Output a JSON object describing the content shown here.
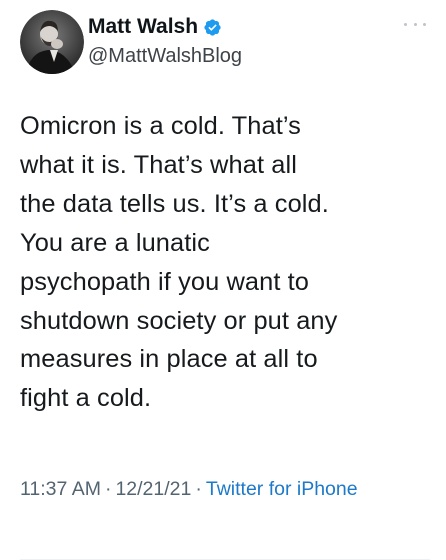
{
  "author": {
    "display_name": "Matt Walsh",
    "handle": "@MattWalshBlog",
    "verified": true
  },
  "icons": {
    "verified": "verified-badge-icon",
    "more": "more-options-icon",
    "avatar": "profile-avatar"
  },
  "tweet": {
    "text": "Omicron is a cold. That’s\nwhat it is. That’s what all\nthe data tells us. It’s a cold.\nYou are a lunatic\npsychopath if you want to\nshutdown society or put any\nmeasures in place at all to\nfight a cold."
  },
  "meta": {
    "time": "11:37 AM",
    "separator": "·",
    "date": "12/21/21",
    "source": "Twitter for iPhone"
  },
  "colors": {
    "text": "#0f1419",
    "secondary": "#536471",
    "link": "#1d7ac9",
    "verified": "#1d9bf0"
  }
}
